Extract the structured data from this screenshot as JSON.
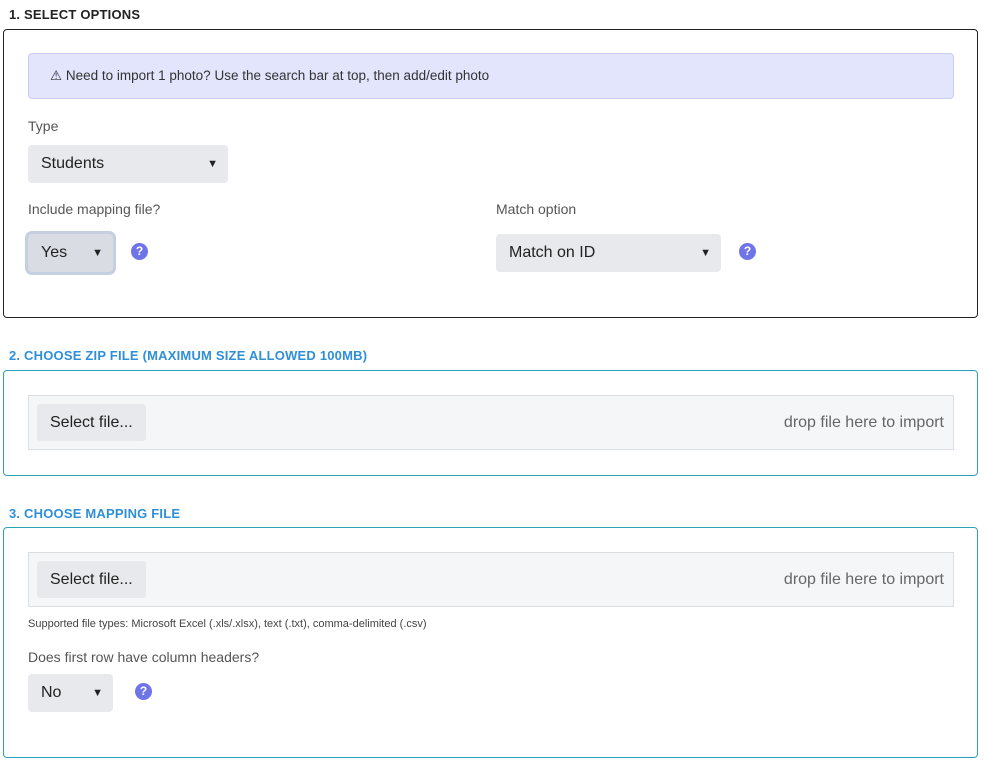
{
  "section1": {
    "title": "1. SELECT OPTIONS",
    "alert": "⚠ Need to import 1 photo? Use the search bar at top, then add/edit photo",
    "type_label": "Type",
    "type_value": "Students",
    "mapping_label": "Include mapping file?",
    "mapping_value": "Yes",
    "match_label": "Match option",
    "match_value": "Match on ID",
    "help_glyph": "?"
  },
  "section2": {
    "title": "2. CHOOSE ZIP FILE (MAXIMUM SIZE ALLOWED 100MB)",
    "select_button": "Select file...",
    "drop_text": "drop file here to import"
  },
  "section3": {
    "title": "3. CHOOSE MAPPING FILE",
    "select_button": "Select file...",
    "drop_text": "drop file here to import",
    "supported_types": "Supported file types: Microsoft Excel (.xls/.xlsx), text (.txt), comma-delimited (.csv)",
    "headers_label": "Does first row have column headers?",
    "headers_value": "No"
  },
  "colors": {
    "accent": "#2f8fd8",
    "help": "#6f74e6",
    "panel_border": "#2aa3b6",
    "alert_bg": "#e2e5fc"
  },
  "icons": {
    "caret": "▼"
  }
}
